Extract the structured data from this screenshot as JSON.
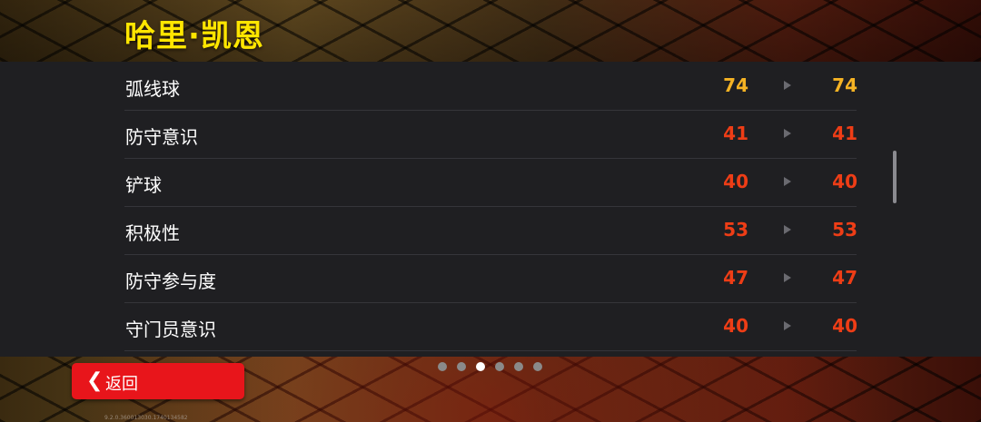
{
  "player_name": "哈里·凯恩",
  "colors": {
    "title": "#ffe600",
    "value_yellow": "#f5b324",
    "value_red": "#ee3d16",
    "back_button": "#e8151b"
  },
  "stats": [
    {
      "label": "弧线球",
      "before": "74",
      "after": "74",
      "color": "#f5b324"
    },
    {
      "label": "防守意识",
      "before": "41",
      "after": "41",
      "color": "#ee3d16"
    },
    {
      "label": "铲球",
      "before": "40",
      "after": "40",
      "color": "#ee3d16"
    },
    {
      "label": "积极性",
      "before": "53",
      "after": "53",
      "color": "#ee3d16"
    },
    {
      "label": "防守参与度",
      "before": "47",
      "after": "47",
      "color": "#ee3d16"
    },
    {
      "label": "守门员意识",
      "before": "40",
      "after": "40",
      "color": "#ee3d16"
    }
  ],
  "arrow_icon": "play-triangle-icon",
  "pagination": {
    "total": 6,
    "active": 3
  },
  "back_button": {
    "label": "返回",
    "icon": "chevron-left-icon"
  },
  "version": "9.2.0.360013030.1740134582"
}
